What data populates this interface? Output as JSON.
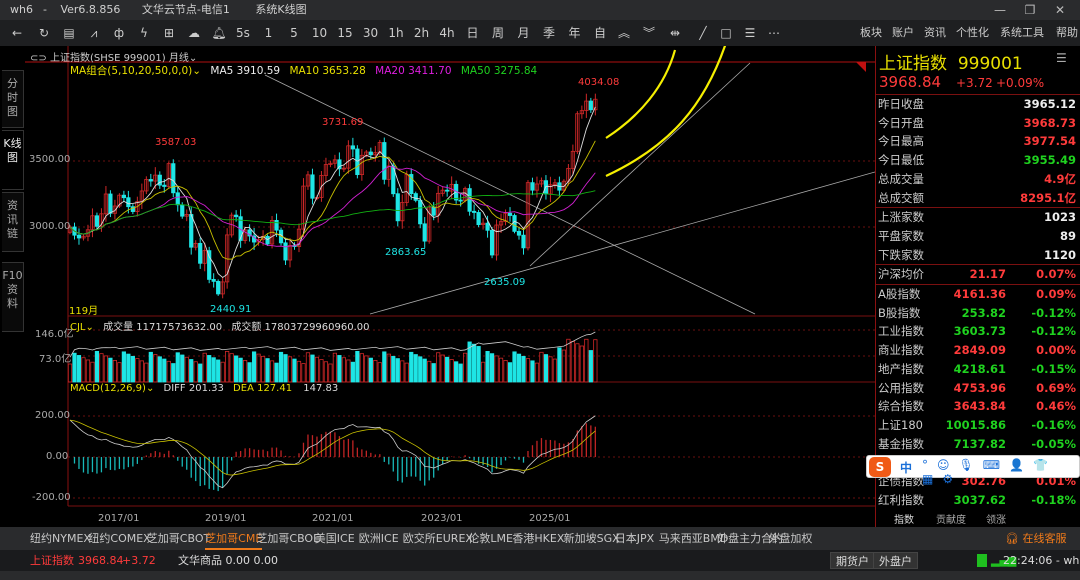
{
  "titlebar": {
    "app": "wh6",
    "version": "Ver6.8.856",
    "server": "文华云节点-电信1",
    "view": "系统K线图"
  },
  "toolbar": {
    "periods": [
      "5s",
      "1",
      "5",
      "10",
      "15",
      "30",
      "1h",
      "2h",
      "4h",
      "日",
      "周",
      "月",
      "季",
      "年",
      "自"
    ],
    "menus": [
      "板块",
      "账户",
      "资讯",
      "个性化",
      "系统工具",
      "帮助"
    ]
  },
  "chart": {
    "symbol": "上证指数(SHSE 999001)",
    "period": "月线",
    "ma": {
      "title": "MA组合(5,10,20,50,0,0)",
      "ma5": "MA5 3910.59",
      "ma10": "MA10 3653.28",
      "ma20": "MA20 3411.70",
      "ma50": "MA50 3275.84"
    },
    "side_tabs": [
      "分时图",
      "K线图",
      "资讯链",
      "F10资料"
    ],
    "price_ticks": [
      "3500.00",
      "3000.00"
    ],
    "annotations": {
      "high1": "3587.03",
      "high2": "3731.69",
      "high3": "4034.08",
      "low1": "2440.91",
      "low2": "2863.65",
      "low3": "2635.09"
    },
    "bar_count": "119月",
    "volume": {
      "title": "CJL",
      "vol": "成交量 11717573632.00",
      "amount": "成交额 17803729960960.00",
      "ticks": [
        "146.0亿",
        "73.0亿"
      ]
    },
    "macd": {
      "title": "MACD(12,26,9)",
      "diff": "DIFF 201.33",
      "dea": "DEA 127.41",
      "macd": "147.83",
      "ticks": [
        "200.00",
        "0.00",
        "-200.00"
      ]
    },
    "dates": [
      "2017/01",
      "2019/01",
      "2021/01",
      "2023/01",
      "2025/01"
    ],
    "closes": [
      3000,
      2938,
      2917,
      2930,
      2979,
      3085,
      3005,
      3100,
      3250,
      3104,
      3159,
      3241,
      3222,
      3154,
      3117,
      3192,
      3273,
      3360,
      3348,
      3393,
      3317,
      3307,
      3480,
      3259,
      3168,
      3082,
      3095,
      2847,
      2876,
      2725,
      2821,
      2603,
      2588,
      2493,
      2584,
      2940,
      3090,
      3078,
      2898,
      2978,
      2932,
      2886,
      2905,
      2929,
      2871,
      3050,
      2976,
      2880,
      2750,
      2860,
      2852,
      2984,
      3310,
      3395,
      3218,
      3224,
      3391,
      3473,
      3483,
      3509,
      3441,
      3446,
      3615,
      3591,
      3397,
      3543,
      3568,
      3547,
      3563,
      3640,
      3361,
      3462,
      3252,
      3047,
      3186,
      3398,
      3253,
      3202,
      3024,
      2893,
      3151,
      3089,
      3255,
      3279,
      3272,
      3323,
      3204,
      3202,
      3291,
      3119,
      3110,
      3018,
      3029,
      2975,
      2788,
      3015,
      3041,
      3104,
      3087,
      2967,
      2938,
      2842,
      3336,
      3279,
      3326,
      3351,
      3250,
      3320,
      3335,
      3279,
      3347,
      3444,
      3573,
      3858,
      3882,
      3954,
      3888,
      3968
    ]
  },
  "quote": {
    "name": "上证指数",
    "code": "999001",
    "price": "3968.84",
    "change": "+3.72",
    "pct": "+0.09%",
    "stats": [
      {
        "k": "昨日收盘",
        "v": "3965.12",
        "c": "wht"
      },
      {
        "k": "今日开盘",
        "v": "3968.73",
        "c": "red"
      },
      {
        "k": "今日最高",
        "v": "3977.54",
        "c": "red"
      },
      {
        "k": "今日最低",
        "v": "3955.49",
        "c": "grn"
      },
      {
        "k": "总成交量",
        "v": "4.9亿",
        "c": "red"
      },
      {
        "k": "总成交额",
        "v": "8295.1亿",
        "c": "red"
      }
    ],
    "breadth": [
      {
        "k": "上涨家数",
        "v": "1023"
      },
      {
        "k": "平盘家数",
        "v": "89"
      },
      {
        "k": "下跌家数",
        "v": "1120"
      }
    ],
    "avg": {
      "k": "沪深均价",
      "m": "21.17",
      "v": "0.07%"
    },
    "indices": [
      {
        "k": "A股指数",
        "m": "4161.36",
        "v": "0.09%",
        "c": "red"
      },
      {
        "k": "B股指数",
        "m": "253.82",
        "v": "-0.12%",
        "c": "grn"
      },
      {
        "k": "工业指数",
        "m": "3603.73",
        "v": "-0.12%",
        "c": "grn"
      },
      {
        "k": "商业指数",
        "m": "2849.09",
        "v": "0.00%",
        "c": "red"
      },
      {
        "k": "地产指数",
        "m": "4218.61",
        "v": "-0.15%",
        "c": "grn"
      },
      {
        "k": "公用指数",
        "m": "4753.96",
        "v": "0.69%",
        "c": "red"
      },
      {
        "k": "综合指数",
        "m": "3643.84",
        "v": "0.46%",
        "c": "red"
      },
      {
        "k": "上证180",
        "m": "10015.86",
        "v": "-0.16%",
        "c": "grn"
      },
      {
        "k": "基金指数",
        "m": "7137.82",
        "v": "-0.05%",
        "c": "grn"
      },
      {
        "k": "",
        "m": "",
        "v": "",
        "c": "red"
      },
      {
        "k": "企债指数",
        "m": "302.76",
        "v": "0.01%",
        "c": "red"
      },
      {
        "k": "红利指数",
        "m": "3037.62",
        "v": "-0.18%",
        "c": "grn"
      }
    ],
    "tabs": [
      "指数",
      "贡献度",
      "领涨"
    ]
  },
  "markets": {
    "tabs": [
      "纽约NYMEX",
      "纽约COMEX",
      "芝加哥CBOT",
      "芝加哥CME",
      "芝加哥CBOE",
      "美国ICE",
      "欧洲ICE",
      "欧交所EUREX",
      "伦敦LME",
      "香港HKEX",
      "新加坡SGX",
      "日本JPX",
      "马来西亚BMD",
      "外盘主力合约",
      "外盘加权"
    ],
    "active": 3,
    "service": "在线客服"
  },
  "status": {
    "index": "上证指数",
    "price": "3968.84",
    "change": "+3.72",
    "commodity": "文华商品 0.00 0.00",
    "btn1": "期货户",
    "btn2": "外盘户",
    "time": "22:24:06 - wh"
  },
  "ime": {
    "lang": "中"
  }
}
